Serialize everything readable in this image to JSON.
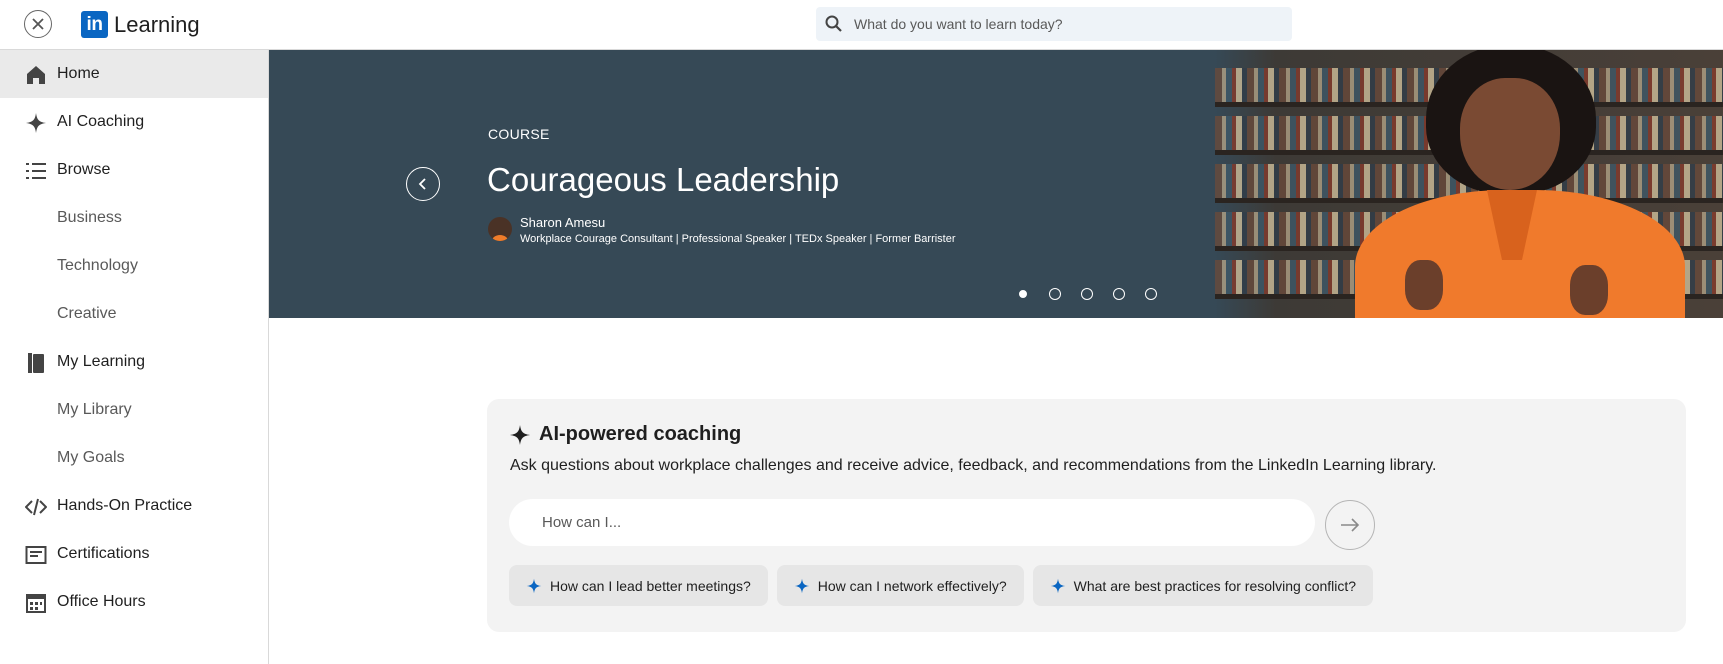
{
  "app": {
    "brand_logo": "in",
    "brand_text": "Learning"
  },
  "search": {
    "placeholder": "What do you want to learn today?"
  },
  "sidebar": {
    "items": [
      {
        "label": "Home",
        "icon": "home-icon"
      },
      {
        "label": "AI Coaching",
        "icon": "sparkle-icon"
      },
      {
        "label": "Browse",
        "icon": "list-icon"
      },
      {
        "label": "Business"
      },
      {
        "label": "Technology"
      },
      {
        "label": "Creative"
      },
      {
        "label": "My Learning",
        "icon": "book-icon"
      },
      {
        "label": "My Library"
      },
      {
        "label": "My Goals"
      },
      {
        "label": "Hands-On Practice",
        "icon": "code-icon"
      },
      {
        "label": "Certifications",
        "icon": "certificate-icon"
      },
      {
        "label": "Office Hours",
        "icon": "calendar-icon"
      }
    ]
  },
  "hero": {
    "kicker": "COURSE",
    "title": "Courageous Leadership",
    "author_name": "Sharon Amesu",
    "author_title": "Workplace Courage Consultant | Professional Speaker | TEDx Speaker | Former Barrister",
    "slides_total": 5,
    "active_slide": 1
  },
  "coaching": {
    "title": "AI-powered coaching",
    "description": "Ask questions about workplace challenges and receive advice, feedback, and recommendations from the LinkedIn Learning library.",
    "input_placeholder": "How can I...",
    "suggestions": [
      "How can I lead better meetings?",
      "How can I network effectively?",
      "What are best practices for resolving conflict?"
    ]
  },
  "colors": {
    "brand_blue": "#0a66c2",
    "hero_bg": "#364956",
    "active_nav_bg": "#eaeaea",
    "card_bg": "#f3f3f3"
  }
}
